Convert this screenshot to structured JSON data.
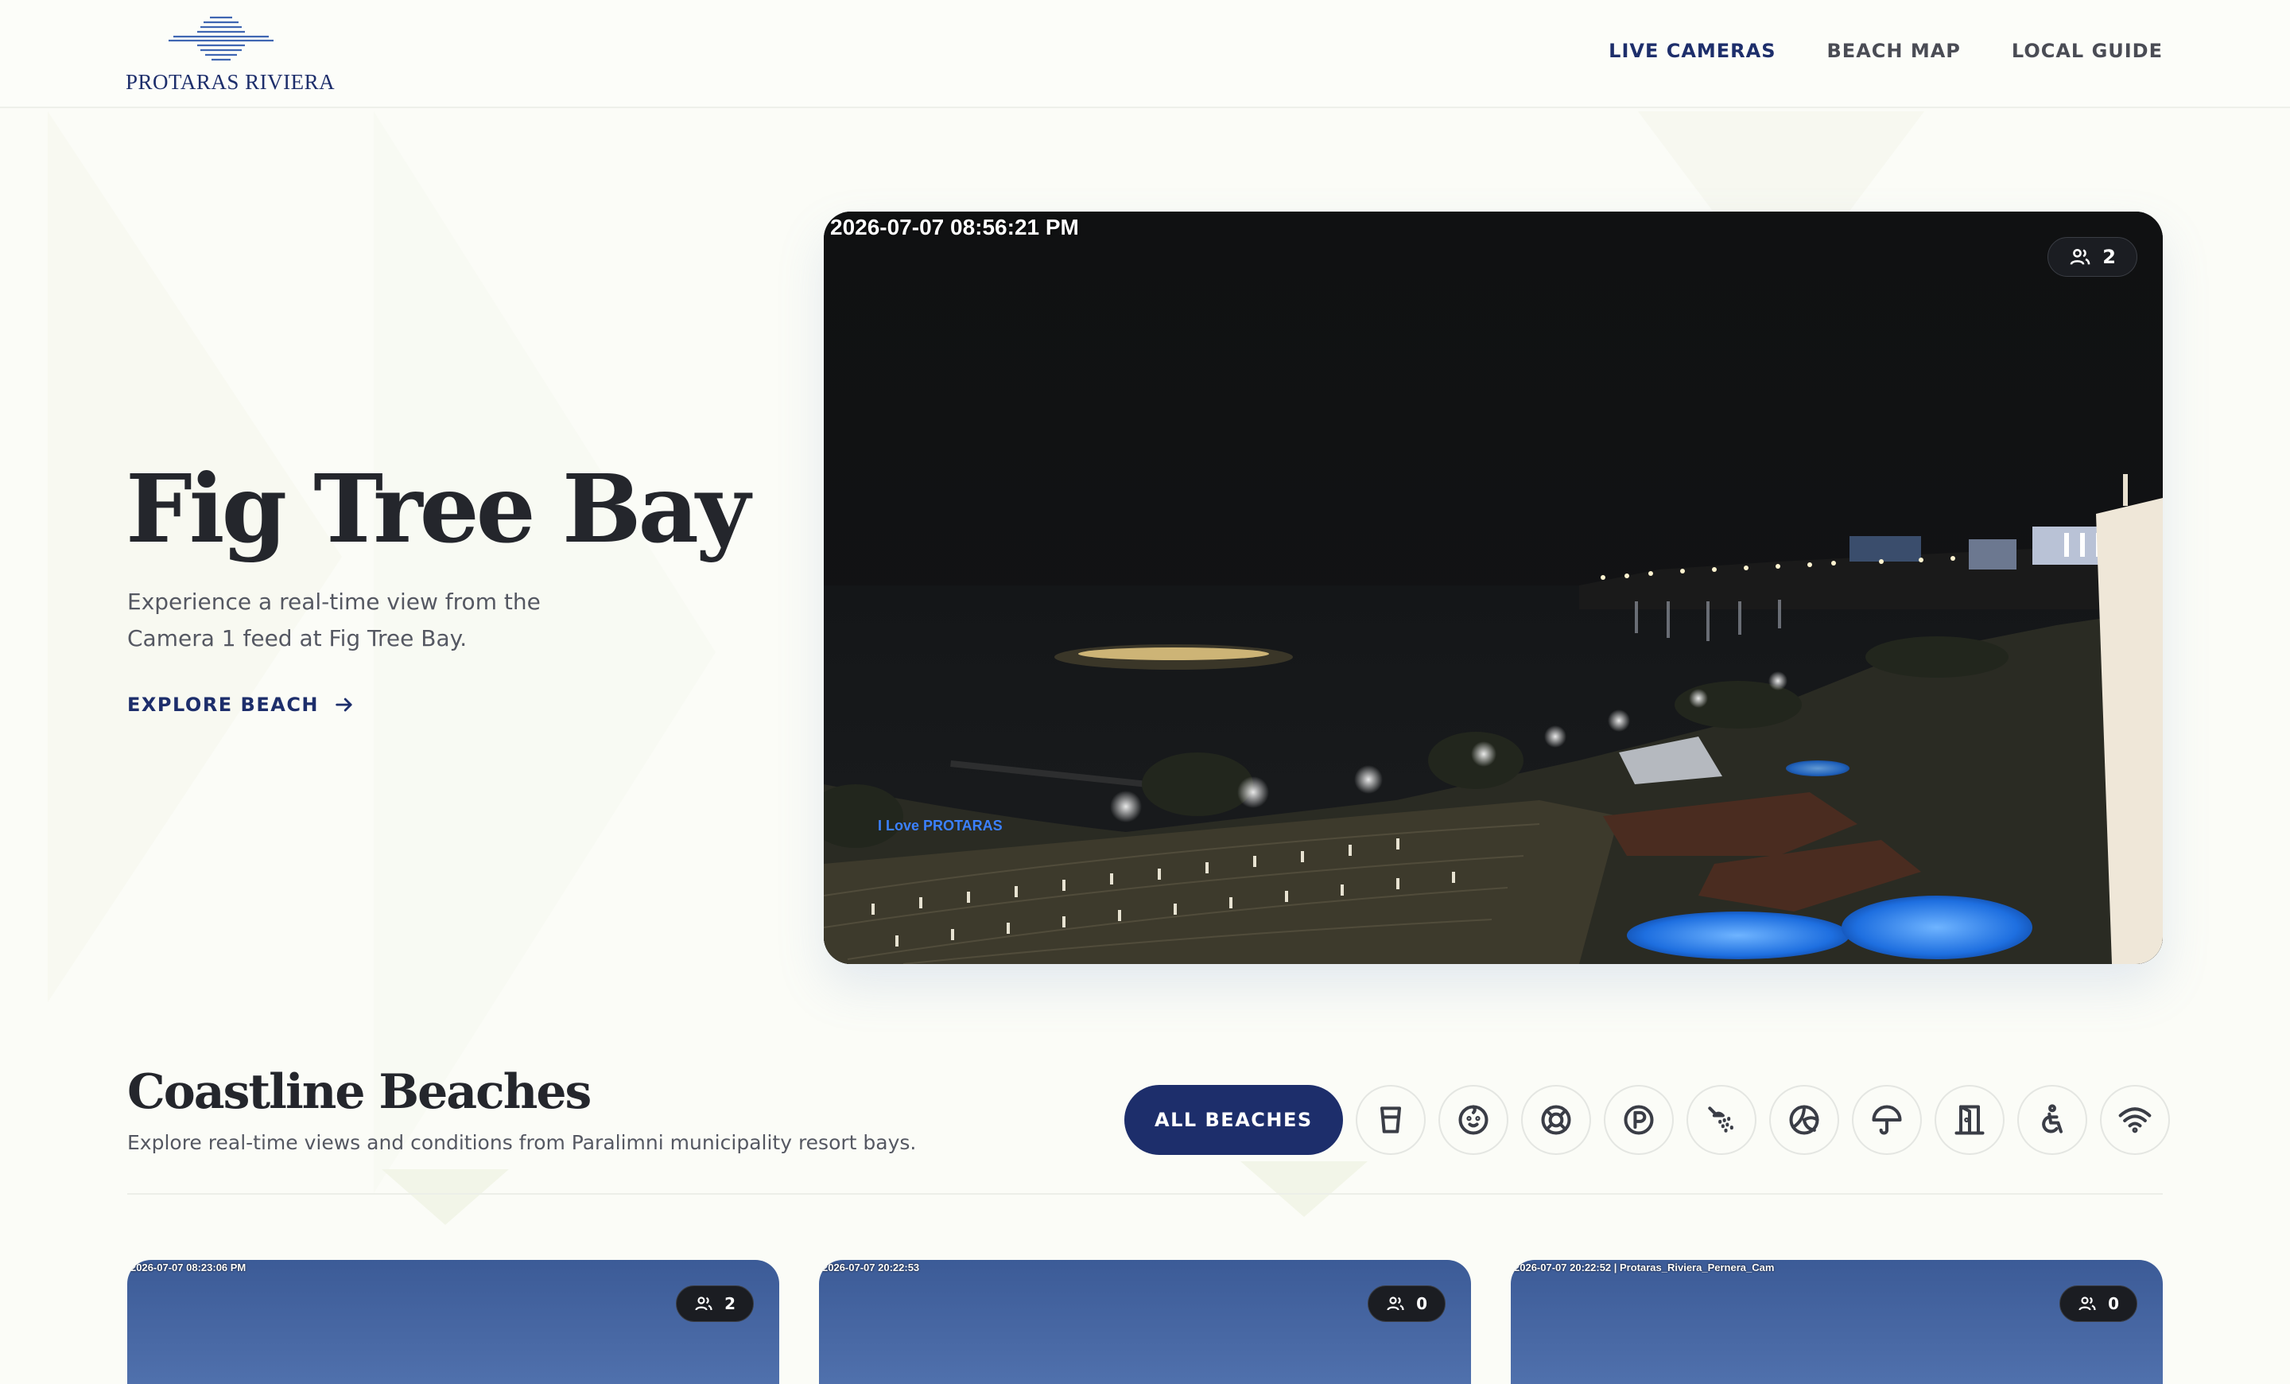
{
  "brand": {
    "name": "PROTARAS RIVIERA",
    "accent": "#1d2e6b"
  },
  "nav": {
    "items": [
      "LIVE CAMERAS",
      "BEACH MAP",
      "LOCAL GUIDE"
    ],
    "active": "LIVE CAMERAS"
  },
  "hero": {
    "title": "Fig Tree Bay",
    "description": "Experience a real-time view from the Camera 1 feed at Fig Tree Bay.",
    "cta": "EXPLORE BEACH",
    "camera": {
      "timestamp": "2026-07-07 08:56:21 PM",
      "viewers": "2",
      "sign_text": "I Love PROTARAS"
    }
  },
  "coastline": {
    "title": "Coastline Beaches",
    "subtitle": "Explore real-time views and conditions from Paralimni municipality resort bays.",
    "all_label": "ALL BEACHES",
    "filters": [
      "cup-icon",
      "baby-icon",
      "lifebuoy-icon",
      "parking-icon",
      "shower-icon",
      "volleyball-icon",
      "umbrella-icon",
      "changing-room-icon",
      "accessibility-icon",
      "wifi-icon"
    ],
    "cards": [
      {
        "timestamp": "2026-07-07 08:23:06 PM",
        "viewers": "2"
      },
      {
        "timestamp": "2026-07-07 20:22:53",
        "viewers": "0"
      },
      {
        "timestamp": "2026-07-07 20:22:52 | Protaras_Riviera_Pernera_Cam",
        "viewers": "0"
      }
    ]
  }
}
